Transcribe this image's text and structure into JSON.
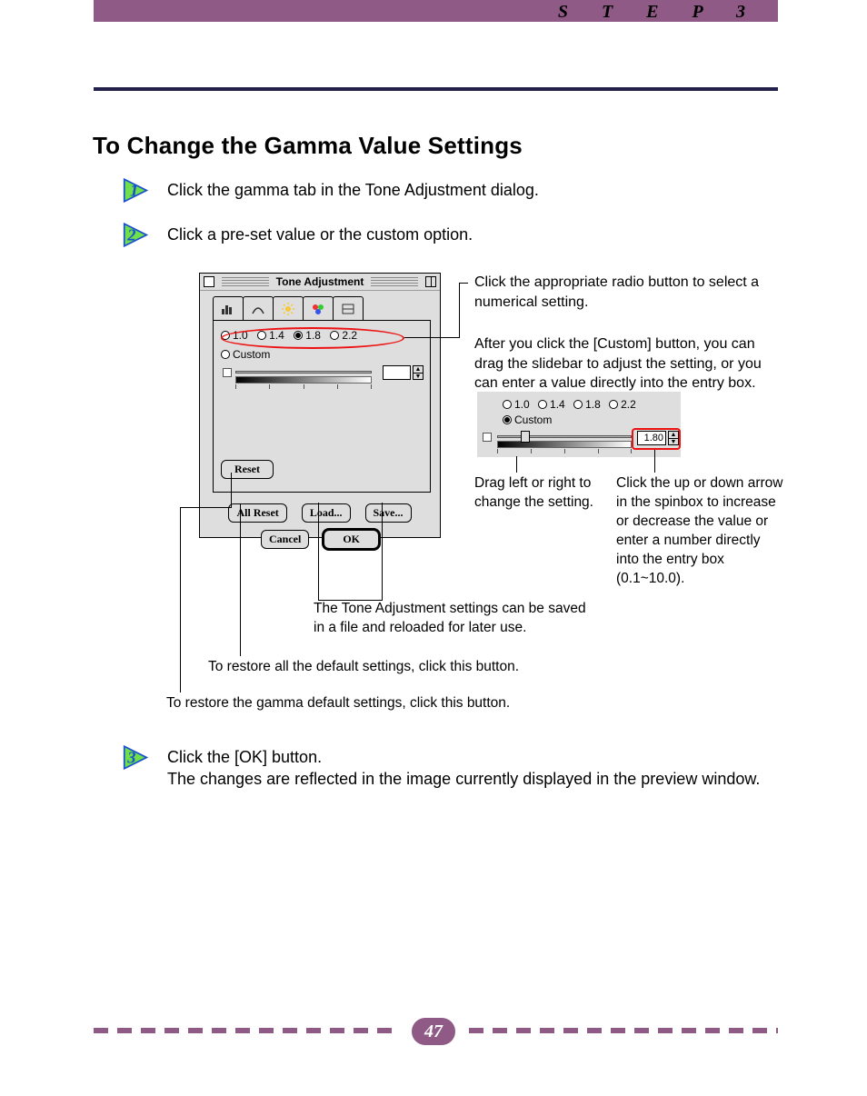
{
  "header": {
    "step_label": "S T E P   3"
  },
  "title": "To Change the Gamma Value Settings",
  "steps": [
    {
      "num": "1",
      "text": "Click the gamma tab in the Tone Adjustment dialog."
    },
    {
      "num": "2",
      "text": "Click a pre-set value or the custom option."
    },
    {
      "num": "3",
      "heading": "Click the [OK] button.",
      "body": "The changes are reflected in the image currently displayed in the preview window."
    }
  ],
  "callouts": {
    "radio_select": "Click the appropriate radio button to select a numerical setting.",
    "after_custom": "After you click the [Custom] button, you can drag the slidebar to adjust the setting, or you can enter a value directly into the entry box.",
    "drag": "Drag left or right to change the setting.",
    "spin": "Click the up or down arrow in the spinbox to increase or decrease the value or enter a number directly into the entry box (0.1~10.0).",
    "save_note": "The Tone Adjustment settings can be saved in a file and reloaded for later use.",
    "allreset_note": "To restore all the default settings, click this button.",
    "reset_note": "To restore the gamma default settings, click this button."
  },
  "dialog": {
    "title": "Tone Adjustment",
    "tabs": [
      "histogram-icon",
      "curves-icon",
      "brightness-icon",
      "gamma-icon",
      "balance-icon"
    ],
    "radios": [
      "1.0",
      "1.4",
      "1.8",
      "2.2"
    ],
    "radio_selected": "1.8",
    "custom_label": "Custom",
    "entry_value_blank": "",
    "buttons": {
      "reset": "Reset",
      "all_reset": "All Reset",
      "load": "Load...",
      "save": "Save...",
      "cancel": "Cancel",
      "ok": "OK"
    }
  },
  "panel2": {
    "radios": [
      "1.0",
      "1.4",
      "1.8",
      "2.2"
    ],
    "custom_label": "Custom",
    "custom_selected": true,
    "entry_value": "1.80"
  },
  "page_number": "47"
}
